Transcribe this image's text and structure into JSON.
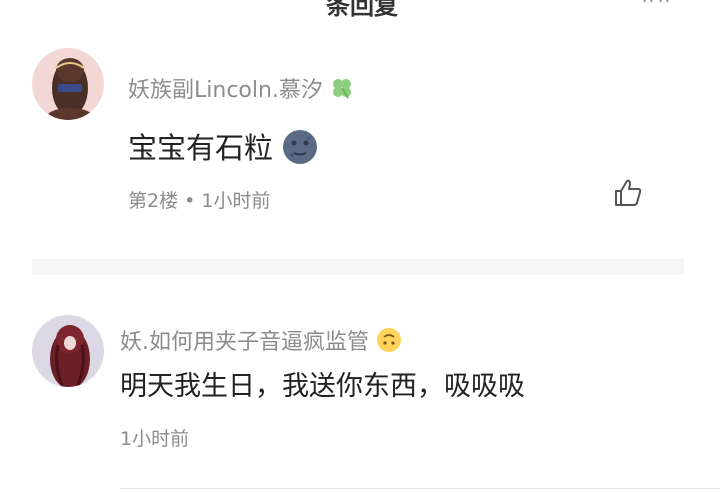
{
  "header": {
    "title": "条回复"
  },
  "comments": [
    {
      "username": "妖族副Lincoln.慕汐",
      "name_badge_icon": "four-leaf-clover-icon",
      "text": "宝宝有石粒",
      "text_emoji_icon": "new-moon-face-icon",
      "floor": "第2楼",
      "separator": "•",
      "time": "1小时前",
      "like_icon": "thumbs-up-icon"
    },
    {
      "username": "妖.如何用夹子音逼疯监管",
      "name_badge_icon": "upside-down-face-icon",
      "text": "明天我生日，我送你东西，吸吸吸",
      "time": "1小时前"
    }
  ],
  "colors": {
    "name": "#8c8c8c",
    "text": "#222222",
    "separator": "#f6f6f6"
  }
}
